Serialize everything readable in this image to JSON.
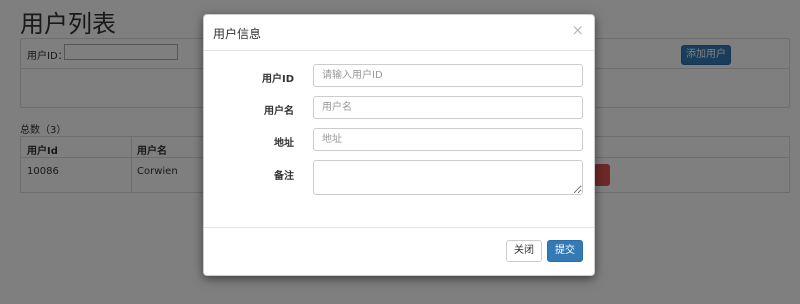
{
  "page": {
    "title": "用户列表",
    "filter_label": "用户ID：",
    "filter_value": "",
    "add_button": "添加用户",
    "total": "总数（3）"
  },
  "table": {
    "columns": [
      "用户Id",
      "用户名"
    ],
    "rows": [
      {
        "id": "10086",
        "name": "Corwien"
      }
    ]
  },
  "modal": {
    "title": "用户信息",
    "close_glyph": "×",
    "fields": [
      {
        "label": "用户ID",
        "placeholder": "请输入用户ID",
        "value": ""
      },
      {
        "label": "用户名",
        "placeholder": "用户名",
        "value": ""
      },
      {
        "label": "地址",
        "placeholder": "地址",
        "value": ""
      },
      {
        "label": "备注",
        "placeholder": "",
        "value": ""
      }
    ],
    "close_button": "关闭",
    "submit_button": "提交"
  },
  "colors": {
    "primary": "#337ab7",
    "danger": "#d9534f",
    "backdrop": "rgba(0,0,0,0.5)"
  },
  "icons": {
    "close": "close-icon",
    "resize": "resize-grip-icon"
  }
}
